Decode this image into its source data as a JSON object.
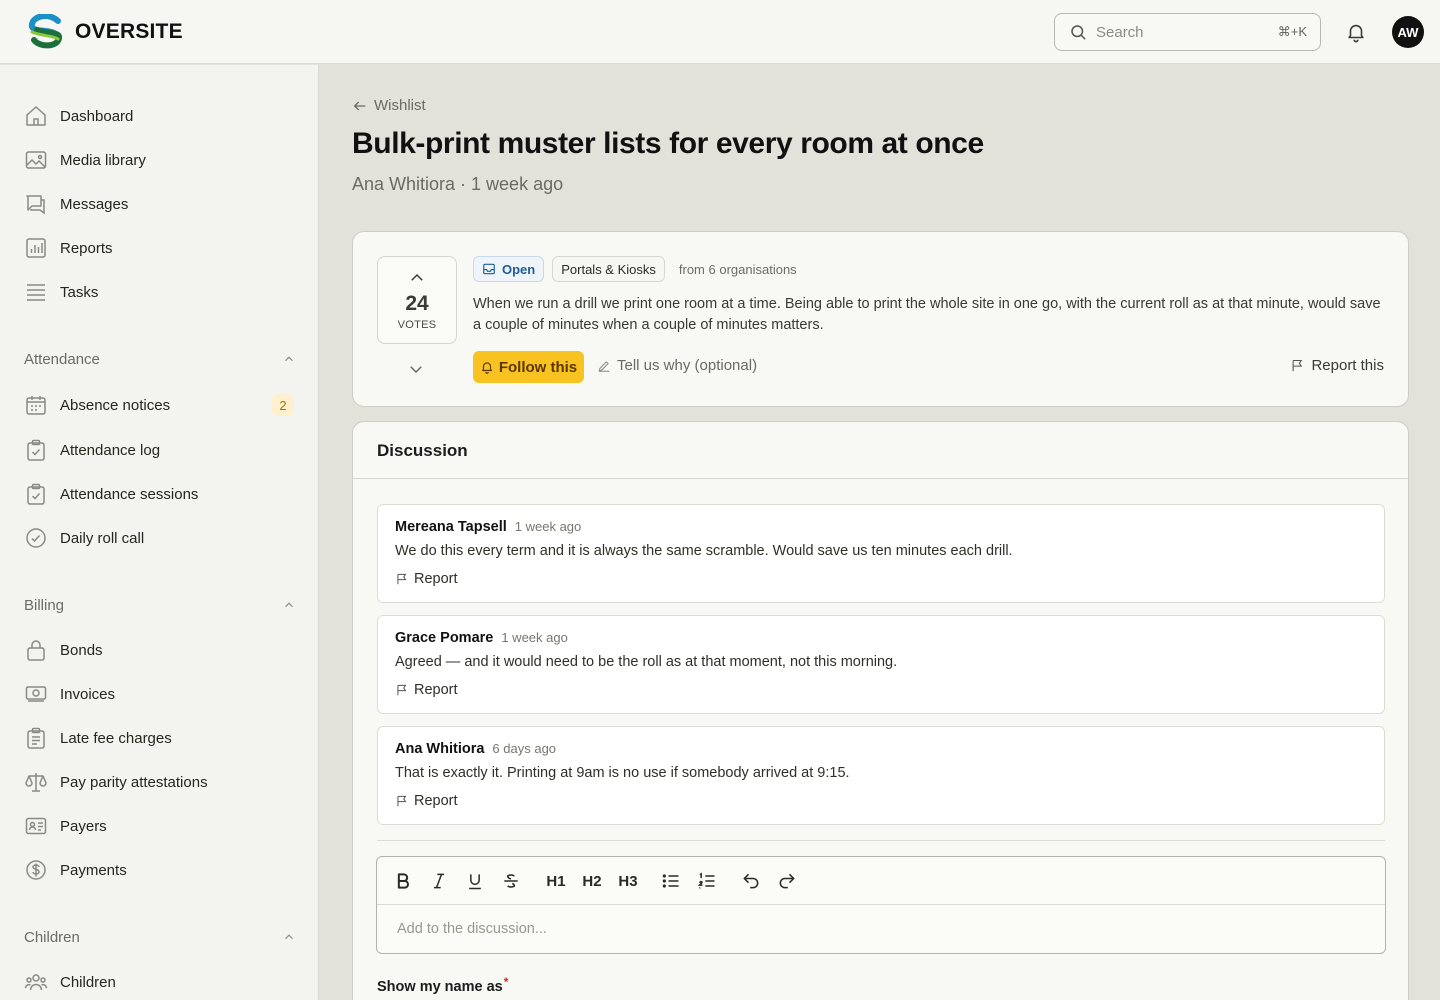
{
  "app": {
    "name": "OVERSITE"
  },
  "header": {
    "search_placeholder": "Search",
    "search_shortcut": "⌘+K",
    "avatar_initials": "AW"
  },
  "sidebar": {
    "top_items": [
      {
        "label": "Dashboard",
        "icon": "home-icon"
      },
      {
        "label": "Media library",
        "icon": "image-icon"
      },
      {
        "label": "Messages",
        "icon": "chat-icon"
      },
      {
        "label": "Reports",
        "icon": "chart-icon"
      },
      {
        "label": "Tasks",
        "icon": "list-icon"
      }
    ],
    "sections": [
      {
        "title": "Attendance",
        "items": [
          {
            "label": "Absence notices",
            "badge": "2"
          },
          {
            "label": "Attendance log"
          },
          {
            "label": "Attendance sessions"
          },
          {
            "label": "Daily roll call"
          }
        ]
      },
      {
        "title": "Billing",
        "items": [
          {
            "label": "Bonds"
          },
          {
            "label": "Invoices"
          },
          {
            "label": "Late fee charges"
          },
          {
            "label": "Pay parity attestations"
          },
          {
            "label": "Payers"
          },
          {
            "label": "Payments"
          }
        ]
      },
      {
        "title": "Children",
        "items": [
          {
            "label": "Children"
          }
        ]
      }
    ]
  },
  "page": {
    "breadcrumb": "Wishlist",
    "title": "Bulk-print muster lists for every room at once",
    "meta": "Ana Whitiora · 1 week ago"
  },
  "idea": {
    "votes": "24",
    "votes_label": "VOTES",
    "status": "Open",
    "category": "Portals & Kiosks",
    "organisations": "from 6 organisations",
    "description": "When we run a drill we print one room at a time. Being able to print the whole site in one go, with the current roll as at that minute, would save a couple of minutes when a couple of minutes matters.",
    "follow_label": "Follow this",
    "why_label": "Tell us why (optional)",
    "report_label": "Report this"
  },
  "discussion": {
    "title": "Discussion",
    "comments": [
      {
        "author": "Mereana Tapsell",
        "time": "1 week ago",
        "text": "We do this every term and it is always the same scramble. Would save us ten minutes each drill.",
        "report": "Report"
      },
      {
        "author": "Grace Pomare",
        "time": "1 week ago",
        "text": "Agreed — and it would need to be the roll as at that moment, not this morning.",
        "report": "Report"
      },
      {
        "author": "Ana Whitiora",
        "time": "6 days ago",
        "text": "That is exactly it. Printing at 9am is no use if somebody arrived at 9:15.",
        "report": "Report"
      }
    ],
    "editor_placeholder": "Add to the discussion...",
    "toolbar": {
      "h1": "H1",
      "h2": "H2",
      "h3": "H3"
    },
    "name_label": "Show my name as",
    "required_mark": "*"
  },
  "colors": {
    "accent": "#f8c320",
    "badge": "#fdf0cf",
    "open_tag": "#1f5d99"
  }
}
